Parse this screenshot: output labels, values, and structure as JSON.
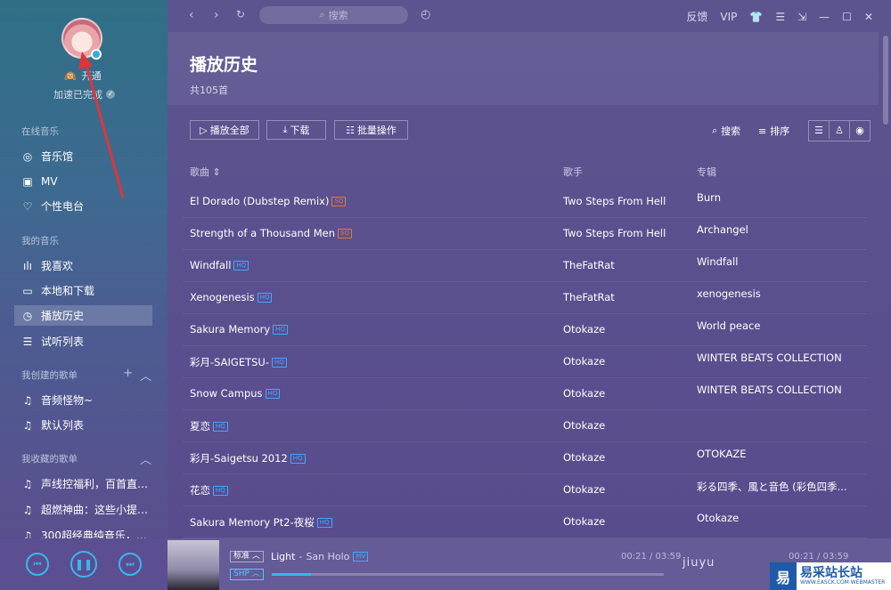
{
  "sidebar": {
    "user": {
      "name_prefix": "🙉",
      "name": "开通",
      "status": "加速已完成"
    },
    "section_online": "在线音乐",
    "online_items": [
      {
        "icon": "disc-icon",
        "label": "音乐馆"
      },
      {
        "icon": "mv-icon",
        "label": "MV"
      },
      {
        "icon": "heart-icon",
        "label": "个性电台"
      }
    ],
    "section_mine": "我的音乐",
    "mine_items": [
      {
        "icon": "bars-icon",
        "label": "我喜欢"
      },
      {
        "icon": "monitor-icon",
        "label": "本地和下载"
      },
      {
        "icon": "clock-icon",
        "label": "播放历史"
      },
      {
        "icon": "list-icon",
        "label": "试听列表"
      }
    ],
    "section_created": "我创建的歌单",
    "created_items": [
      {
        "icon": "note-icon",
        "label": "音频怪物~"
      },
      {
        "icon": "note-icon",
        "label": "默认列表"
      }
    ],
    "section_collected": "我收藏的歌单",
    "collected_items": [
      {
        "icon": "note-icon",
        "label": "声线控福利，百首直击..."
      },
      {
        "icon": "note-icon",
        "label": "超燃神曲：这些小提琴..."
      },
      {
        "icon": "note-icon",
        "label": "300超经典纯音乐，听..."
      }
    ]
  },
  "topbar": {
    "search_placeholder": "搜索",
    "feedback": "反馈",
    "vip": "VIP"
  },
  "page": {
    "title": "播放历史",
    "count": "共105首"
  },
  "toolbar": {
    "play_all": "播放全部",
    "download": "下载",
    "batch": "批量操作",
    "search": "搜索",
    "sort": "排序"
  },
  "columns": {
    "song": "歌曲",
    "artist": "歌手",
    "album": "专辑"
  },
  "songs": [
    {
      "title": "El Dorado (Dubstep Remix)",
      "badge": "SQ",
      "artist": "Two Steps From Hell",
      "album": "Burn"
    },
    {
      "title": "Strength of a Thousand Men",
      "badge": "SQ",
      "artist": "Two Steps From Hell",
      "album": "Archangel"
    },
    {
      "title": "Windfall",
      "badge": "HQ",
      "artist": "TheFatRat",
      "album": "Windfall"
    },
    {
      "title": "Xenogenesis",
      "badge": "HQ",
      "artist": "TheFatRat",
      "album": "xenogenesis"
    },
    {
      "title": "Sakura Memory",
      "badge": "HQ",
      "artist": "Otokaze",
      "album": "World peace"
    },
    {
      "title": "彩月-SAIGETSU-",
      "badge": "HQ",
      "artist": "Otokaze",
      "album": "WINTER BEATS COLLECTION"
    },
    {
      "title": "Snow Campus",
      "badge": "HQ",
      "artist": "Otokaze",
      "album": "WINTER BEATS COLLECTION"
    },
    {
      "title": "夏恋",
      "badge": "HQ",
      "artist": "Otokaze",
      "album": ""
    },
    {
      "title": "彩月-Saigetsu 2012",
      "badge": "HQ",
      "artist": "Otokaze",
      "album": "OTOKAZE"
    },
    {
      "title": "花恋",
      "badge": "HQ",
      "artist": "Otokaze",
      "album": "彩る四季、風と音色 (彩色四季..."
    },
    {
      "title": "Sakura Memory Pt2-夜桜",
      "badge": "HQ",
      "artist": "Otokaze",
      "album": "Otokaze"
    }
  ],
  "player": {
    "quality": "标准",
    "format": "SHP",
    "track": "Light",
    "artist_sep": " - ",
    "artist": "San Holo",
    "mv": "MV",
    "time_left": "00:21 / 03:59",
    "time_right": "00:21 / 03:59",
    "progress": 0.1,
    "overlay_text": "jiuyu"
  },
  "watermark": {
    "mark": "易",
    "text": "易采站长站",
    "sub": "WWW.EASCK.COM  WEBMASTER"
  },
  "colors": {
    "accent": "#38b7f0",
    "hq": "#40a8ff",
    "sq": "#e8753b",
    "arrow": "#e0343a"
  }
}
